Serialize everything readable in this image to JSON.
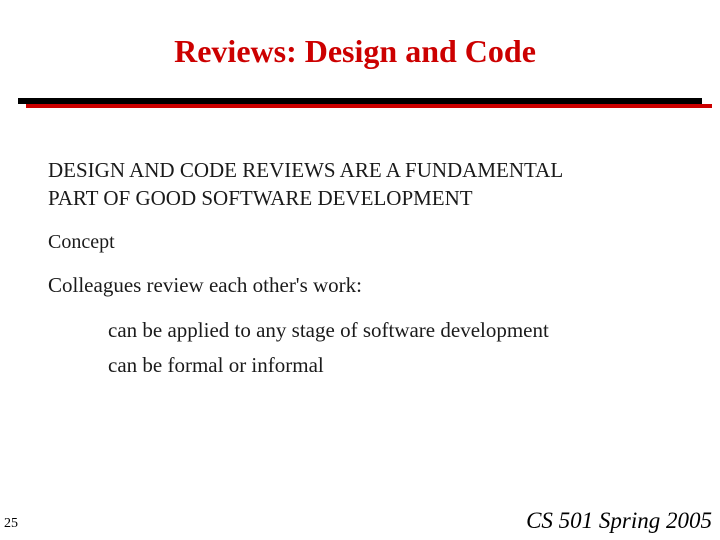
{
  "slide": {
    "title": "Reviews: Design and Code",
    "heading_line1": "DESIGN AND CODE REVIEWS ARE A FUNDAMENTAL",
    "heading_line2": "PART OF GOOD SOFTWARE DEVELOPMENT",
    "concept_label": "Concept",
    "colleagues_text": "Colleagues review each other's work:",
    "sub_points": [
      "can be applied to any stage of software development",
      "can be formal or informal"
    ]
  },
  "footer": {
    "page_number": "25",
    "course": "CS 501 Spring 2005"
  },
  "colors": {
    "title": "#cc0000",
    "rule_black": "#000000",
    "rule_red": "#cc0000",
    "text": "#1a1a1a"
  }
}
